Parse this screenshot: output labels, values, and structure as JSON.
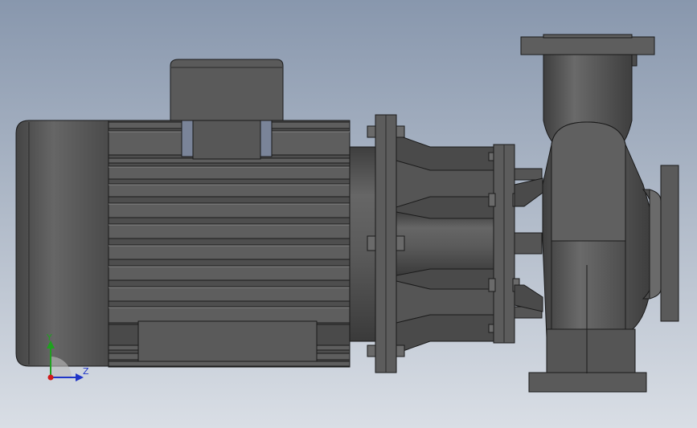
{
  "scene": {
    "subject": "centrifugal-pump-motor-assembly",
    "background_top": "#8897ad",
    "background_bottom": "#d9dee5"
  },
  "triad": {
    "y_label": "Y",
    "z_label": "Z",
    "y_color": "#1ea11e",
    "z_color": "#1f35c8",
    "origin_color": "#d11a1a"
  },
  "colors": {
    "body": "#565656",
    "body_light": "#6a6a6a",
    "body_dark": "#3c3c3c",
    "outline": "#1a1a1a"
  }
}
